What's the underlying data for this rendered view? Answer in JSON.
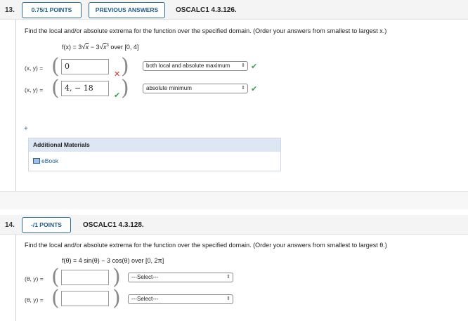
{
  "q13": {
    "number": "13.",
    "score_button": "0.75/1 POINTS",
    "previous_button": "PREVIOUS ANSWERS",
    "problem_id": "OSCALC1 4.3.126.",
    "prompt": "Find the local and/or absolute extrema for the function over the specified domain. (Order your answers from smallest to largest x.)",
    "function": {
      "lhs": "f(x) = 3",
      "var1": "x",
      "mid": " − 3",
      "var2": "x",
      "exp": "3",
      "domain": " over [0, 4]"
    },
    "row1": {
      "label": "(x, y)  =",
      "value": "0",
      "select": "both local and absolute maximum",
      "status": "incorrect"
    },
    "row2": {
      "label": "(x, y)  =",
      "value": "4,  − 18",
      "select": "absolute minimum",
      "status": "correct"
    },
    "expand_glyph": "+",
    "materials": {
      "title": "Additional Materials",
      "link": "eBook"
    }
  },
  "q14": {
    "number": "14.",
    "score_button": "-/1 POINTS",
    "problem_id": "OSCALC1 4.3.128.",
    "prompt": "Find the local and/or absolute extrema for the function over the specified domain. (Order your answers from smallest to largest θ.)",
    "function": "f(θ) = 4 sin(θ) − 3 cos(θ) over [0, 2π]",
    "row1": {
      "label": "(θ, y)  =",
      "value": "",
      "select": "---Select---"
    },
    "row2": {
      "label": "(θ, y)  =",
      "value": "",
      "select": "---Select---"
    }
  },
  "colors": {
    "accent": "#1e5a8a",
    "correct": "#3aa14a",
    "incorrect": "#d0342c"
  },
  "icons": {
    "correct": "check-icon",
    "incorrect": "x-mark-icon",
    "select_arrow": "updown-arrow-icon",
    "book": "book-icon"
  }
}
